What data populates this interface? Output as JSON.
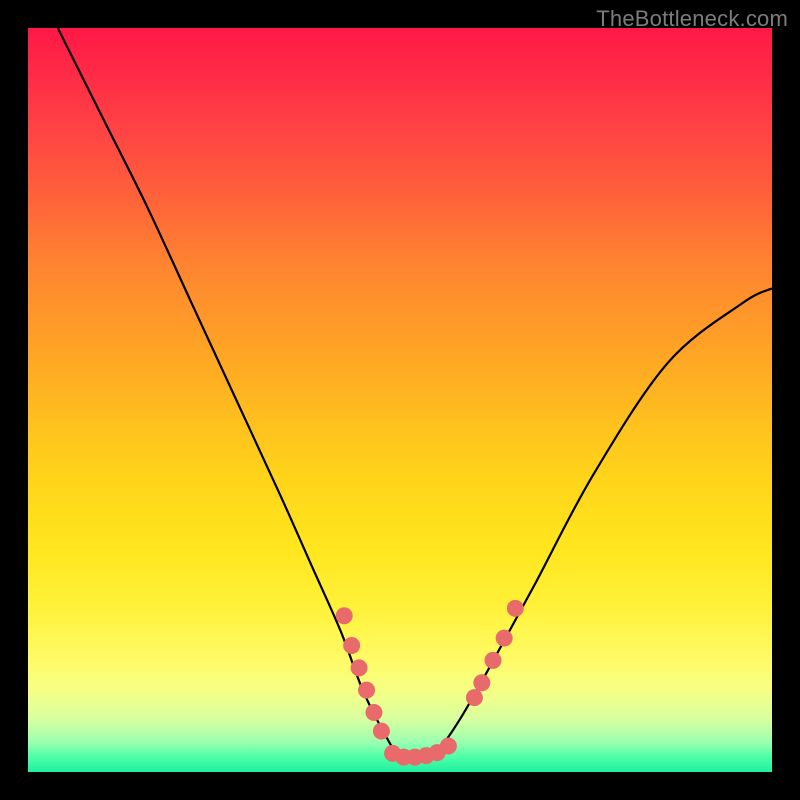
{
  "watermark": "TheBottleneck.com",
  "colors": {
    "frame": "#000000",
    "curve": "#000000",
    "dots": "#e86a6a"
  },
  "chart_data": {
    "type": "line",
    "title": "",
    "xlabel": "",
    "ylabel": "",
    "xlim": [
      0,
      100
    ],
    "ylim": [
      0,
      100
    ],
    "note": "Axes are normalized 0–100 (no visible tick labels in source).",
    "series": [
      {
        "name": "bottleneck-curve",
        "x": [
          4,
          10,
          16,
          22,
          28,
          34,
          38,
          42,
          45,
          48,
          50,
          52,
          55,
          58,
          62,
          68,
          76,
          86,
          96,
          100
        ],
        "y": [
          100,
          88,
          76,
          63,
          50,
          37,
          28,
          19,
          11,
          5,
          2,
          2,
          3,
          7,
          14,
          25,
          40,
          55,
          63,
          65
        ]
      }
    ],
    "marker_clusters": [
      {
        "name": "left-cluster",
        "points": [
          {
            "x": 42.5,
            "y": 21
          },
          {
            "x": 43.5,
            "y": 17
          },
          {
            "x": 44.5,
            "y": 14
          },
          {
            "x": 45.5,
            "y": 11
          },
          {
            "x": 46.5,
            "y": 8
          },
          {
            "x": 47.5,
            "y": 5.5
          }
        ]
      },
      {
        "name": "bottom-cluster",
        "points": [
          {
            "x": 49,
            "y": 2.5
          },
          {
            "x": 50.5,
            "y": 2
          },
          {
            "x": 52,
            "y": 2
          },
          {
            "x": 53.5,
            "y": 2.2
          },
          {
            "x": 55,
            "y": 2.6
          },
          {
            "x": 56.5,
            "y": 3.5
          }
        ]
      },
      {
        "name": "right-cluster",
        "points": [
          {
            "x": 60,
            "y": 10
          },
          {
            "x": 61,
            "y": 12
          },
          {
            "x": 62.5,
            "y": 15
          },
          {
            "x": 64,
            "y": 18
          },
          {
            "x": 65.5,
            "y": 22
          }
        ]
      }
    ]
  }
}
